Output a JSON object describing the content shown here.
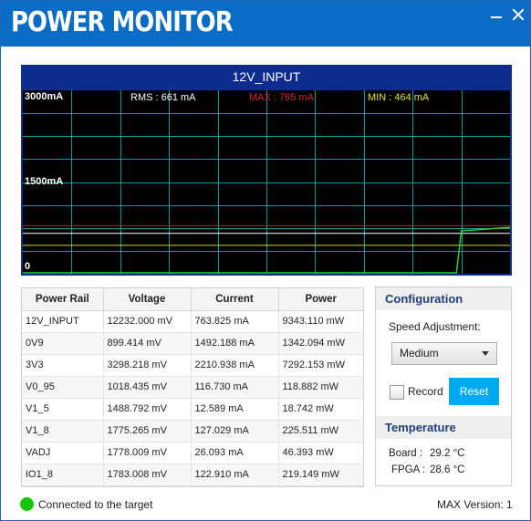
{
  "app": {
    "title": "POWER MONITOR"
  },
  "chart": {
    "title": "12V_INPUT",
    "y_labels": {
      "top": "3000mA",
      "mid": "1500mA",
      "bottom": "0"
    },
    "stats": {
      "rms": "RMS : 661 mA",
      "max": "MAX : 785 mA",
      "min": "MIN : 464 mA"
    },
    "colors": {
      "frame": "#0e2c8e",
      "grid": "#0d9c9c",
      "trace": "#22d33a",
      "max_line": "#c81e1e",
      "min_line": "#d7d72a",
      "rms_text": "#ffffff",
      "max_text": "#d42424",
      "min_text": "#e6e632"
    }
  },
  "chart_data": {
    "type": "line",
    "title": "12V_INPUT",
    "xlabel": "",
    "ylabel": "",
    "ylim": [
      0,
      3000
    ],
    "y_ticks": [
      "0",
      "1500mA",
      "3000mA"
    ],
    "grid": true,
    "series": [
      {
        "name": "",
        "x": [
          0,
          0.88,
          0.89,
          0.9,
          1.0
        ],
        "values": [
          0,
          0,
          0,
          700,
          760
        ]
      }
    ],
    "reference_lines": {
      "rms": 661,
      "max": 785,
      "min": 464
    }
  },
  "table": {
    "headers": [
      "Power Rail",
      "Voltage",
      "Current",
      "Power"
    ],
    "rows": [
      [
        "12V_INPUT",
        "12232.000 mV",
        "763.825 mA",
        "9343.110 mW"
      ],
      [
        "0V9",
        "899.414 mV",
        "1492.188 mA",
        "1342.094 mW"
      ],
      [
        "3V3",
        "3298.218 mV",
        "2210.938 mA",
        "7292.153 mW"
      ],
      [
        "V0_95",
        "1018.435 mV",
        "116.730 mA",
        "118.882 mW"
      ],
      [
        "V1_5",
        "1488.792 mV",
        "12.589 mA",
        "18.742 mW"
      ],
      [
        "V1_8",
        "1775.265 mV",
        "127.029 mA",
        "225.511 mW"
      ],
      [
        "VADJ",
        "1778.009 mV",
        "26.093 mA",
        "46.393 mW"
      ],
      [
        "IO1_8",
        "1783.008 mV",
        "122.910 mA",
        "219.149 mW"
      ]
    ]
  },
  "config": {
    "header": "Configuration",
    "speed_label": "Speed Adjustment:",
    "speed_value": "Medium",
    "record_label": "Record",
    "record_checked": false,
    "reset_label": "Reset"
  },
  "temperature": {
    "header": "Temperature",
    "board_label": "Board :",
    "board_value": "29.2 °C",
    "fpga_label": "FPGA :",
    "fpga_value": "28.6 °C"
  },
  "footer": {
    "status": "Connected to the target",
    "status_color": "#16c60c",
    "version": "MAX Version: 1"
  }
}
